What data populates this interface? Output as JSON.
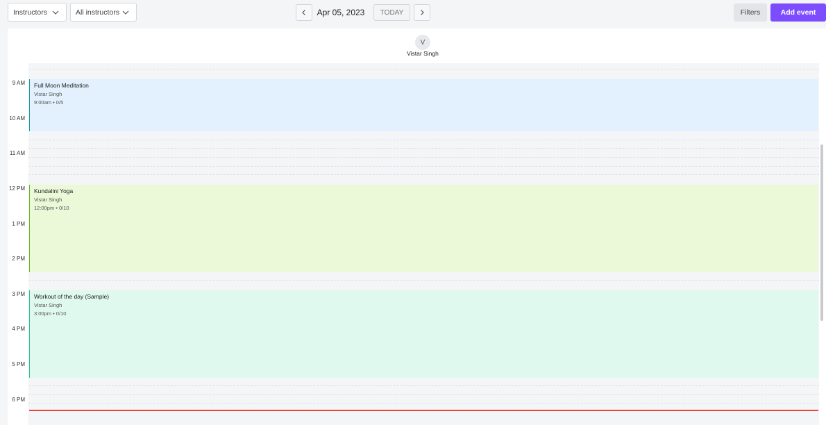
{
  "toolbar": {
    "view_select": "Instructors",
    "instructor_select": "All instructors",
    "date": "Apr 05, 2023",
    "today_label": "TODAY",
    "filters_label": "Filters",
    "add_event_label": "Add event"
  },
  "instructor": {
    "initial": "V",
    "name": "Vistar Singh"
  },
  "time_labels": [
    "9 AM",
    "10 AM",
    "11 AM",
    "12 PM",
    "1 PM",
    "2 PM",
    "3 PM",
    "4 PM",
    "5 PM",
    "6 PM"
  ],
  "events": [
    {
      "title": "Full Moon Meditation",
      "instructor": "Vistar Singh",
      "meta": "9:00am • 0/5",
      "color": "#e2f1fd",
      "accent": "#1a9c9c"
    },
    {
      "title": "Kundalini Yoga",
      "instructor": "Vistar Singh",
      "meta": "12:00pm • 0/10",
      "color": "#ebf9d9",
      "accent": "#66b82a"
    },
    {
      "title": "Workout of the day (Sample)",
      "instructor": "Vistar Singh",
      "meta": "3:00pm • 0/10",
      "color": "#e0f9ef",
      "accent": "#2fc08e"
    }
  ],
  "colors": {
    "accent": "#7c4dff",
    "current_time_line": "#e8483a"
  }
}
